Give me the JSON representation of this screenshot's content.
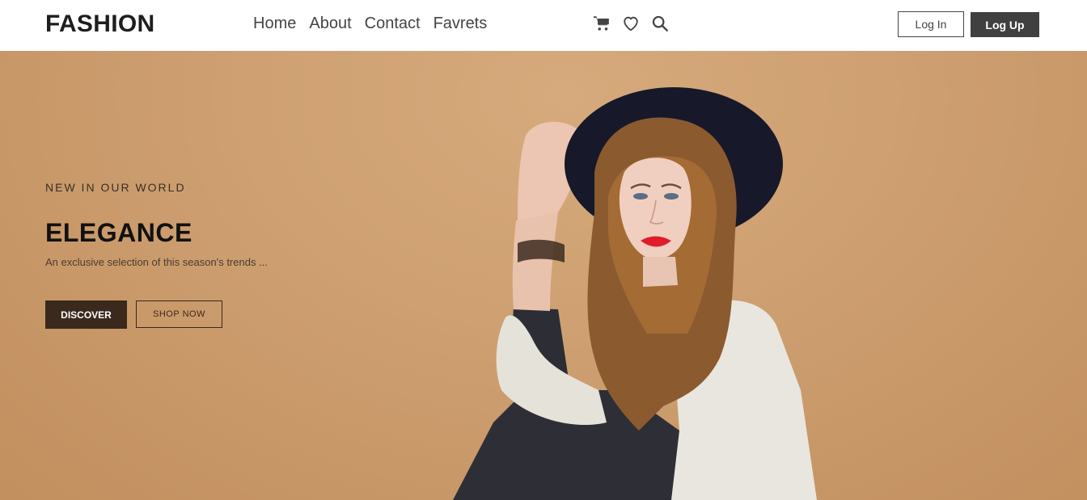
{
  "header": {
    "logo": "FASHION",
    "nav": [
      "Home",
      "About",
      "Contact",
      "Favrets"
    ],
    "icons": [
      "cart-icon",
      "heart-icon",
      "search-icon"
    ],
    "login_label": "Log In",
    "logup_label": "Log Up"
  },
  "hero": {
    "tagline": "NEW IN OUR WORLD",
    "title": "ELEGANCE",
    "subtitle": "An exclusive selection of this season's trends ...",
    "discover_label": "DISCOVER",
    "shop_label": "SHOP NOW"
  },
  "colors": {
    "background": "#cea072",
    "dark_button": "#3a291c",
    "header_button": "#404040"
  }
}
